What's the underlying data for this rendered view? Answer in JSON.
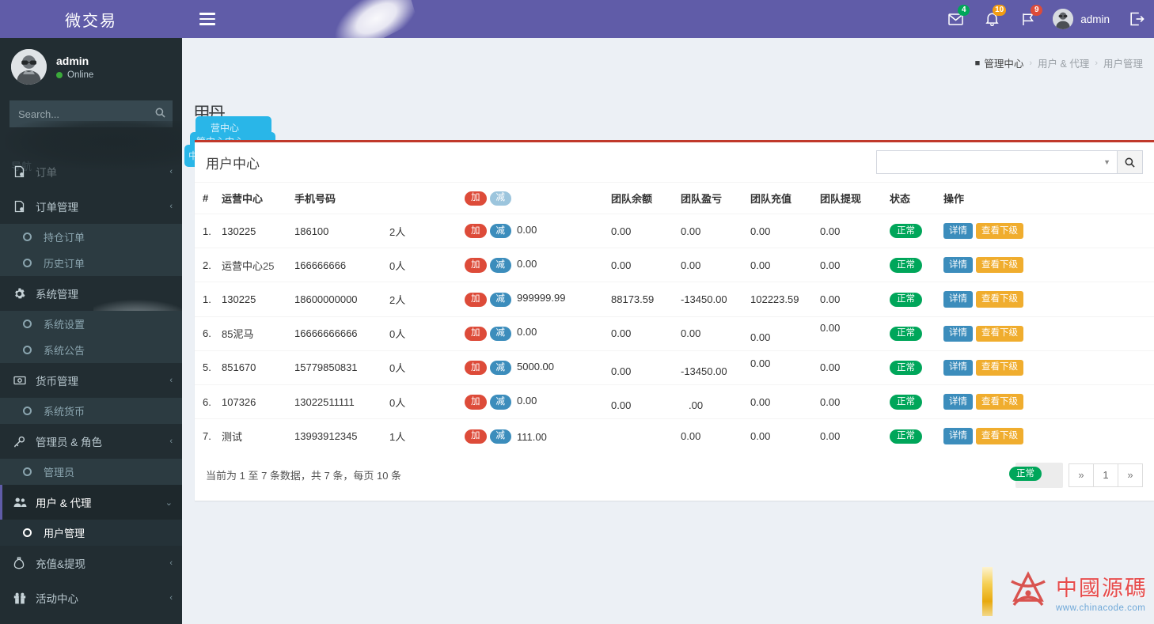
{
  "brand": {
    "title": "微交易"
  },
  "topbar": {
    "icons": [
      {
        "name": "mail-icon",
        "badge": "4",
        "badge_color": "#00a65a"
      },
      {
        "name": "bell-icon",
        "badge": "10",
        "badge_color": "#f39c12"
      },
      {
        "name": "flag-icon",
        "badge": "9",
        "badge_color": "#dd4b39"
      }
    ],
    "user": "admin",
    "logout_icon": "logout-icon",
    "menu_icon": "hamburger-icon"
  },
  "sidebar": {
    "user": {
      "name": "admin",
      "status": "Online"
    },
    "search_placeholder": "Search...",
    "menu_header": "导航",
    "items": [
      {
        "label": "订单",
        "icon": "order-icon",
        "arrow": "‹",
        "type": "top"
      },
      {
        "label": "订单管理",
        "icon": "order-icon",
        "arrow": "‹",
        "type": "top"
      },
      {
        "label": "持仓订单",
        "icon": "circle-icon",
        "type": "sub"
      },
      {
        "label": "历史订单",
        "icon": "circle-icon",
        "type": "sub"
      },
      {
        "label": "系统管理",
        "icon": "gear-icon",
        "arrow": "‹",
        "type": "top"
      },
      {
        "label": "系统设置",
        "icon": "circle-icon",
        "type": "sub"
      },
      {
        "label": "系统公告",
        "icon": "circle-icon",
        "type": "sub"
      },
      {
        "label": "货币管理",
        "icon": "money-icon",
        "arrow": "‹",
        "type": "top"
      },
      {
        "label": "系统货币",
        "icon": "circle-icon",
        "type": "sub"
      },
      {
        "label": "管理员 & 角色",
        "icon": "key-icon",
        "arrow": "‹",
        "type": "top"
      },
      {
        "label": "管理员",
        "icon": "circle-icon",
        "type": "sub"
      },
      {
        "label": "用户 & 代理",
        "icon": "users-icon",
        "arrow": "⌄",
        "type": "top",
        "active": true
      },
      {
        "label": "用户管理",
        "icon": "circle-icon",
        "type": "sub",
        "current": true
      },
      {
        "label": "充值&提现",
        "icon": "wallet-icon",
        "arrow": "‹",
        "type": "top"
      },
      {
        "label": "活动中心",
        "icon": "gift-icon",
        "arrow": "‹",
        "type": "top"
      }
    ]
  },
  "breadcrumb": {
    "home": "管理中心",
    "trail": [
      "用户 & 代理",
      "用户管理"
    ]
  },
  "artifacts": {
    "letters": "甲丹",
    "letters2": "用",
    "ghosts": [
      "营中心",
      "管中心中心",
      "中中心运营中心"
    ]
  },
  "card": {
    "title": "用户中心",
    "search_value": "",
    "search_icon": "search-icon",
    "columns": [
      "#",
      "运营中心",
      "手机号码",
      "",
      "",
      "团队余额",
      "团队盈亏",
      "团队充值",
      "团队提现",
      "状态",
      "操作"
    ],
    "header_add_label": "加",
    "header_sub_label": "减",
    "rows": [
      {
        "idx": "1.",
        "center": "130225",
        "phone": "186100",
        "count": "2人",
        "add": "加",
        "sub": "减",
        "balance": "0.00",
        "team_balance": "0.00",
        "team_pl": "0.00",
        "team_deposit": "0.00",
        "team_withdraw": "0.00",
        "status": "正常",
        "btn_detail": "详情",
        "btn_sub": "查看下级"
      },
      {
        "idx": "2.",
        "center": "运营中心",
        "center_ghost": "25",
        "phone": "166666666",
        "count": "0人",
        "add": "加",
        "sub": "减",
        "balance": "0.00",
        "team_balance": "0.00",
        "team_pl": "0.00",
        "team_deposit": "0.00",
        "team_withdraw": "0.00",
        "status": "正常",
        "btn_detail": "详情",
        "btn_sub": "查看下级"
      },
      {
        "idx": "1.",
        "center": "130225",
        "phone": "18600000000",
        "count": "2人",
        "add": "加",
        "sub": "减",
        "balance": "999999.99",
        "team_balance": "88173.59",
        "team_pl": "-13450.00",
        "team_deposit": "102223.59",
        "team_withdraw": "0.00",
        "status": "正常",
        "btn_detail": "详情",
        "btn_sub": "查看下级"
      },
      {
        "idx": "6.",
        "center": "85泥马",
        "phone": "16666666666",
        "count": "0人",
        "add": "加",
        "sub": "减",
        "balance": "0.00",
        "team_balance": "0.00",
        "team_pl": "0.00",
        "team_deposit": "0.00",
        "team_withdraw": "0.00",
        "status": "正常",
        "btn_detail": "详情",
        "btn_sub": "查看下级"
      },
      {
        "idx": "5.",
        "center": "851670",
        "phone": "15779850831",
        "count": "0人",
        "add": "加",
        "sub": "减",
        "balance": "5000.00",
        "team_balance": "0.00",
        "team_pl": "-13450.00",
        "team_deposit": "0.00",
        "team_withdraw": "0.00",
        "status": "正常",
        "btn_detail": "详情",
        "btn_sub": "查看下级"
      },
      {
        "idx": "6.",
        "center": "107326",
        "phone": "13022511111",
        "count": "0人",
        "add": "加",
        "sub": "减",
        "balance": "0.00",
        "team_balance": "0.00",
        "team_pl": ".00",
        "team_deposit": "0.00",
        "team_withdraw": "0.00",
        "status": "正常",
        "btn_detail": "详情",
        "btn_sub": "查看下级"
      },
      {
        "idx": "7.",
        "center": "测试",
        "phone": "13993912345",
        "count": "1人",
        "add": "加",
        "sub": "减",
        "balance": "111.00",
        "team_balance": "",
        "team_pl": "0.00",
        "team_deposit": "0.00",
        "team_withdraw": "0.00",
        "status": "正常",
        "btn_detail": "详情",
        "btn_sub": "查看下级"
      }
    ],
    "footer_info": "当前为 1 至 7 条数据，共 7 条，每页 10 条",
    "footer_badge_ghost": "正常",
    "pager": {
      "prev": "»",
      "page": "1",
      "next": "»"
    }
  },
  "watermark": {
    "text": "中國源碼",
    "url": "www.chinacode.com"
  }
}
